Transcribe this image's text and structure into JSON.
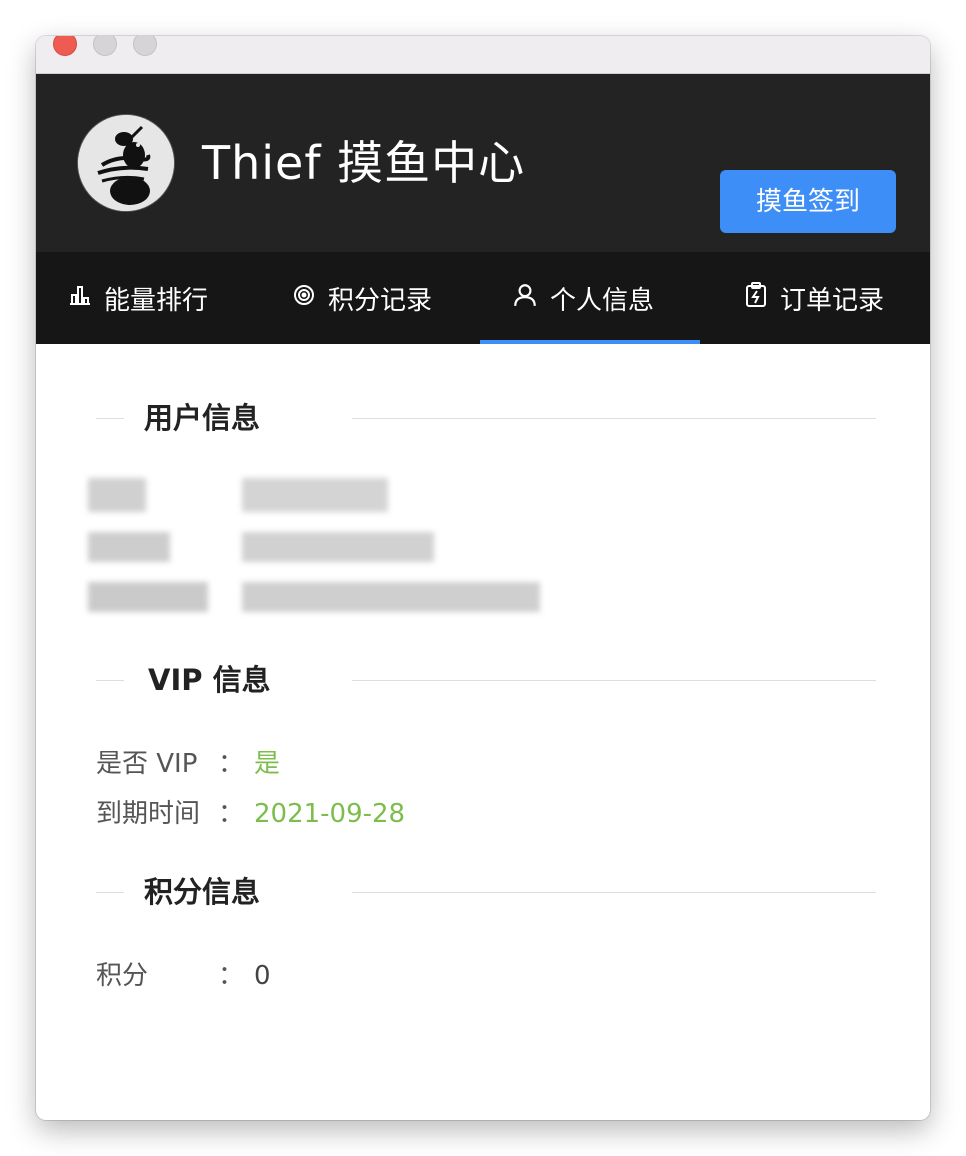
{
  "window": {
    "app_title": "Thief 摸鱼中心",
    "checkin_label": "摸鱼签到"
  },
  "tabs": [
    {
      "label": "能量排行",
      "icon": "bar-chart-icon"
    },
    {
      "label": "积分记录",
      "icon": "spiral-icon"
    },
    {
      "label": "个人信息",
      "icon": "user-icon",
      "active": true
    },
    {
      "label": "订单记录",
      "icon": "clipboard-bolt-icon"
    }
  ],
  "sections": {
    "user": {
      "title": "用户信息"
    },
    "vip": {
      "title": "VIP 信息",
      "is_vip_label": "是否 VIP",
      "is_vip_value": "是",
      "expire_label": "到期时间",
      "expire_value": "2021-09-28",
      "separator": "："
    },
    "points": {
      "title": "积分信息",
      "points_label": "积分",
      "points_value": "0",
      "separator": "："
    }
  },
  "colors": {
    "accent": "#3d8ef7",
    "header_bg": "#232323",
    "tabbar_bg": "#161616",
    "value_green": "#7cbd4e",
    "close_red": "#ee5b53"
  }
}
